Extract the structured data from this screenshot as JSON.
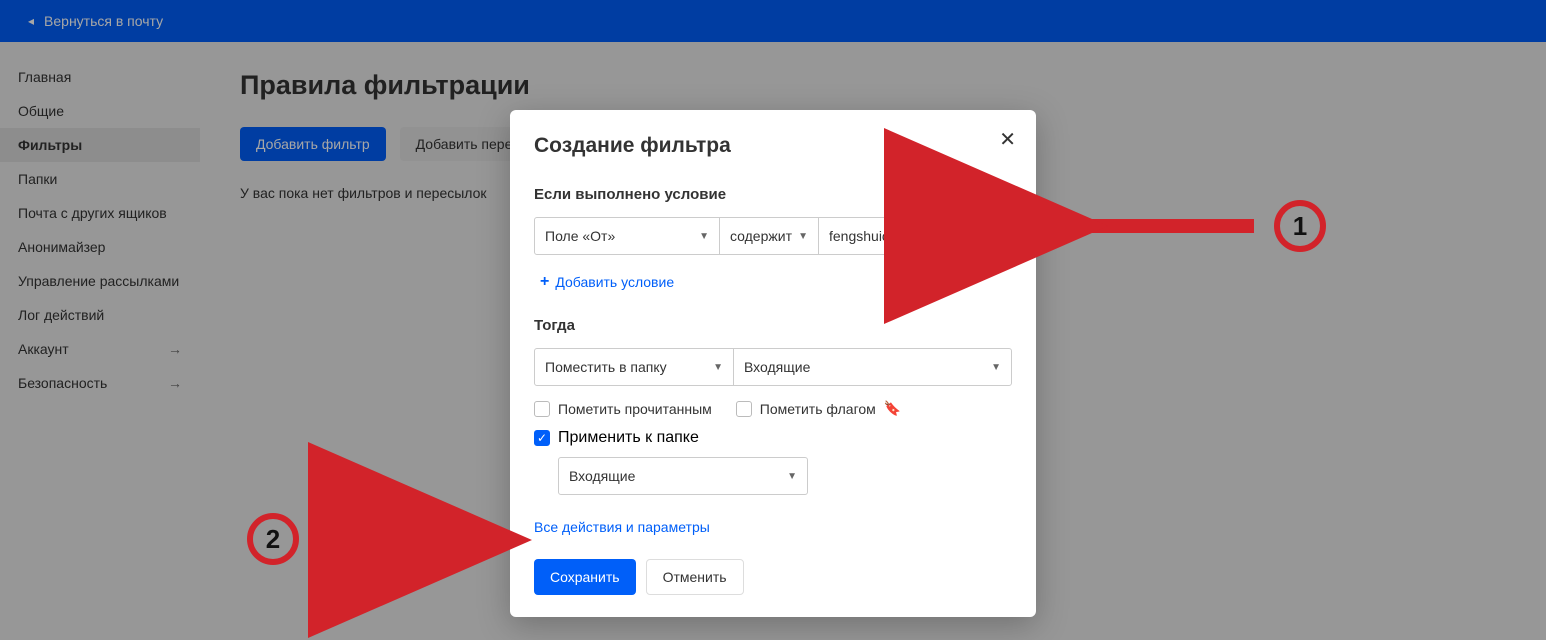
{
  "topbar": {
    "back_label": "Вернуться в почту"
  },
  "sidebar": {
    "items": [
      {
        "label": "Главная",
        "expand": false,
        "active": false
      },
      {
        "label": "Общие",
        "expand": false,
        "active": false
      },
      {
        "label": "Фильтры",
        "expand": false,
        "active": true
      },
      {
        "label": "Папки",
        "expand": false,
        "active": false
      },
      {
        "label": "Почта с других ящиков",
        "expand": false,
        "active": false
      },
      {
        "label": "Анонимайзер",
        "expand": false,
        "active": false
      },
      {
        "label": "Управление рассылками",
        "expand": false,
        "active": false
      },
      {
        "label": "Лог действий",
        "expand": false,
        "active": false
      },
      {
        "label": "Аккаунт",
        "expand": true,
        "active": false
      },
      {
        "label": "Безопасность",
        "expand": true,
        "active": false
      }
    ]
  },
  "main": {
    "title": "Правила фильтрации",
    "add_filter": "Добавить фильтр",
    "add_forward": "Добавить пересылку",
    "empty": "У вас пока нет фильтров и пересылок"
  },
  "modal": {
    "title": "Создание фильтра",
    "cond_label": "Если выполнено условие",
    "cond_field": "Поле «От»",
    "cond_op": "содержит",
    "cond_value": "fengshuicourses@gmail.cor",
    "add_cond": "Добавить условие",
    "then_label": "Тогда",
    "then_action": "Поместить в папку",
    "then_target": "Входящие",
    "check_read": "Пометить прочитанным",
    "check_flag": "Пометить флагом",
    "check_apply": "Применить к папке",
    "apply_folder": "Входящие",
    "all_actions": "Все действия и параметры",
    "save": "Сохранить",
    "cancel": "Отменить"
  },
  "annot": {
    "one": "1",
    "two": "2"
  }
}
